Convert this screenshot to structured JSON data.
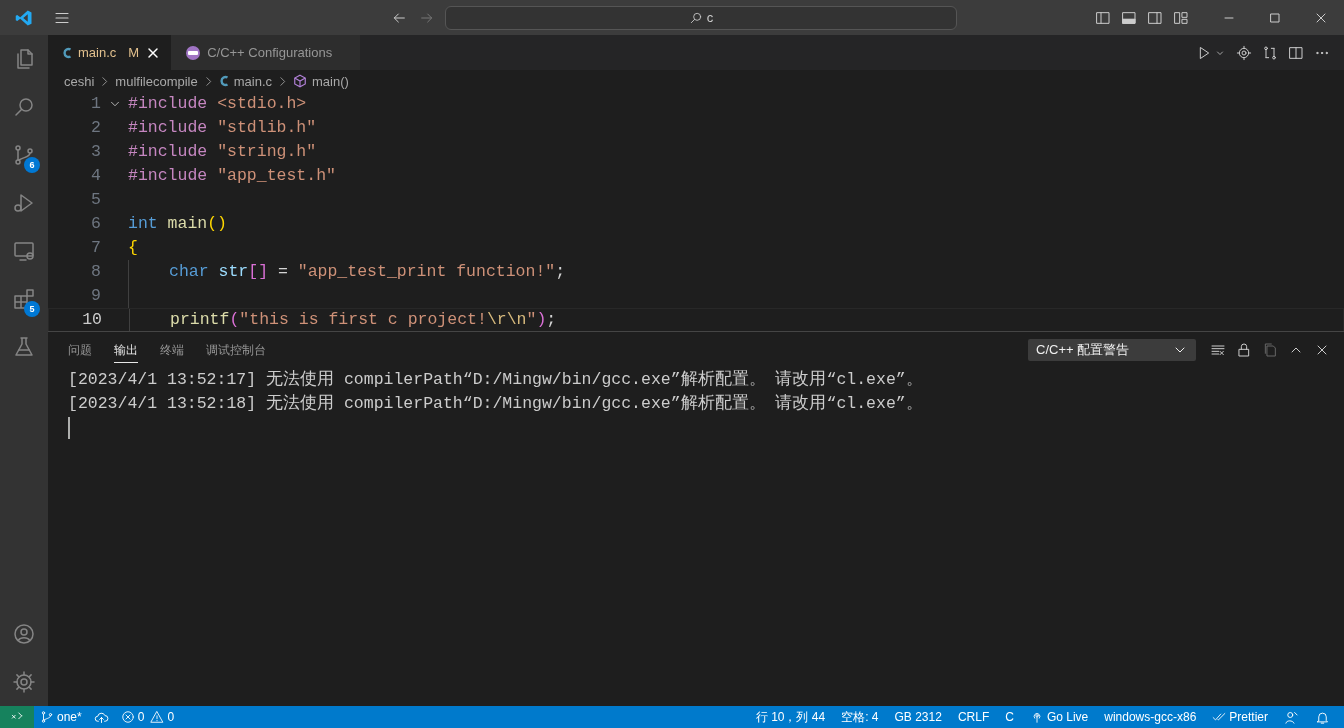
{
  "title_bar": {
    "command_center": {
      "value": "c"
    }
  },
  "activity_bar": {
    "items": [
      {
        "kind": "explorer"
      },
      {
        "kind": "search"
      },
      {
        "kind": "source-control",
        "badge": "6"
      },
      {
        "kind": "run-debug"
      },
      {
        "kind": "remote-explorer"
      },
      {
        "kind": "extensions",
        "badge": "5"
      },
      {
        "kind": "testing"
      }
    ],
    "bottom_items": [
      {
        "kind": "accounts"
      },
      {
        "kind": "manage"
      }
    ]
  },
  "editor": {
    "tabs": [
      {
        "kind": "c-file",
        "label": "main.c",
        "status": "M",
        "selected": true
      },
      {
        "kind": "config",
        "label": "C/C++ Configurations",
        "selected": false
      }
    ],
    "breadcrumbs": [
      {
        "kind": "folder",
        "label": "ceshi"
      },
      {
        "kind": "folder",
        "label": "mulfilecompile"
      },
      {
        "kind": "c-file",
        "label": "main.c"
      },
      {
        "kind": "function",
        "label": "main()"
      }
    ],
    "lines": [
      {
        "number": "1",
        "current": false,
        "fold": true,
        "guide": false,
        "tokens": [
          {
            "text": "#include ",
            "color": "#c586c0"
          },
          {
            "text": "<stdio.h>",
            "color": "#ce9178"
          }
        ]
      },
      {
        "number": "2",
        "current": false,
        "fold": false,
        "guide": false,
        "tokens": [
          {
            "text": "#include ",
            "color": "#c586c0"
          },
          {
            "text": "\"stdlib.h\"",
            "color": "#ce9178"
          }
        ]
      },
      {
        "number": "3",
        "current": false,
        "fold": false,
        "guide": false,
        "tokens": [
          {
            "text": "#include ",
            "color": "#c586c0"
          },
          {
            "text": "\"string.h\"",
            "color": "#ce9178"
          }
        ]
      },
      {
        "number": "4",
        "current": false,
        "fold": false,
        "guide": false,
        "tokens": [
          {
            "text": "#include ",
            "color": "#c586c0"
          },
          {
            "text": "\"app_test.h\"",
            "color": "#ce9178"
          }
        ]
      },
      {
        "number": "5",
        "current": false,
        "fold": false,
        "guide": false
      },
      {
        "number": "6",
        "current": false,
        "fold": false,
        "guide": false,
        "tokens": [
          {
            "text": "int ",
            "color": "#569cd6"
          },
          {
            "text": "main",
            "color": "#dcdcaa"
          },
          {
            "text": "()",
            "color": "#ffd700"
          }
        ]
      },
      {
        "number": "7",
        "current": false,
        "fold": false,
        "guide": false,
        "tokens": [
          {
            "text": "{",
            "color": "#ffd700"
          }
        ]
      },
      {
        "number": "8",
        "current": false,
        "fold": false,
        "guide": true,
        "tokens": [
          {
            "text": "char ",
            "color": "#569cd6"
          },
          {
            "text": "str",
            "color": "#9cdcfe"
          },
          {
            "text": "[]",
            "color": "#da70d6"
          },
          {
            "text": " = ",
            "color": "#d4d4d4"
          },
          {
            "text": "\"app_test_print function!\"",
            "color": "#ce9178"
          },
          {
            "text": ";",
            "color": "#d4d4d4"
          }
        ]
      },
      {
        "number": "9",
        "current": false,
        "fold": false,
        "guide": true
      },
      {
        "number": "10",
        "current": true,
        "fold": false,
        "guide": true,
        "tokens": [
          {
            "text": "printf",
            "color": "#dcdcaa"
          },
          {
            "text": "(",
            "color": "#da70d6"
          },
          {
            "text": "\"this is first c project!",
            "color": "#ce9178"
          },
          {
            "text": "\\r\\n",
            "color": "#d7ba7d"
          },
          {
            "text": "\"",
            "color": "#ce9178"
          },
          {
            "text": ")",
            "color": "#da70d6"
          },
          {
            "text": ";",
            "color": "#d4d4d4"
          }
        ]
      }
    ]
  },
  "panel": {
    "tabs": [
      {
        "label": "问题",
        "selected": false
      },
      {
        "label": "输出",
        "selected": true
      },
      {
        "label": "终端",
        "selected": false
      },
      {
        "label": "调试控制台",
        "selected": false
      }
    ],
    "channel": {
      "value": "C/C++ 配置警告"
    },
    "lines": [
      "[2023/4/1 13:52:17] 无法使用 compilerPath“D:/Mingw/bin/gcc.exe”解析配置。 请改用“cl.exe”。",
      "[2023/4/1 13:52:18] 无法使用 compilerPath“D:/Mingw/bin/gcc.exe”解析配置。 请改用“cl.exe”。"
    ]
  },
  "status_bar": {
    "left": [
      {
        "kind": "remote"
      },
      {
        "kind": "branch",
        "label": "one*"
      },
      {
        "kind": "sync"
      },
      {
        "kind": "problems",
        "errors": "0",
        "warnings": "0"
      }
    ],
    "right": [
      {
        "kind": "text",
        "label": "行 10，列 44"
      },
      {
        "kind": "text",
        "label": "空格: 4"
      },
      {
        "kind": "text",
        "label": "GB 2312"
      },
      {
        "kind": "text",
        "label": "CRLF"
      },
      {
        "kind": "text",
        "label": "C"
      },
      {
        "kind": "golive",
        "label": "Go Live"
      },
      {
        "kind": "text",
        "label": "windows-gcc-x86"
      },
      {
        "kind": "prettier",
        "label": "Prettier"
      },
      {
        "kind": "feedback"
      },
      {
        "kind": "notifications"
      }
    ]
  }
}
